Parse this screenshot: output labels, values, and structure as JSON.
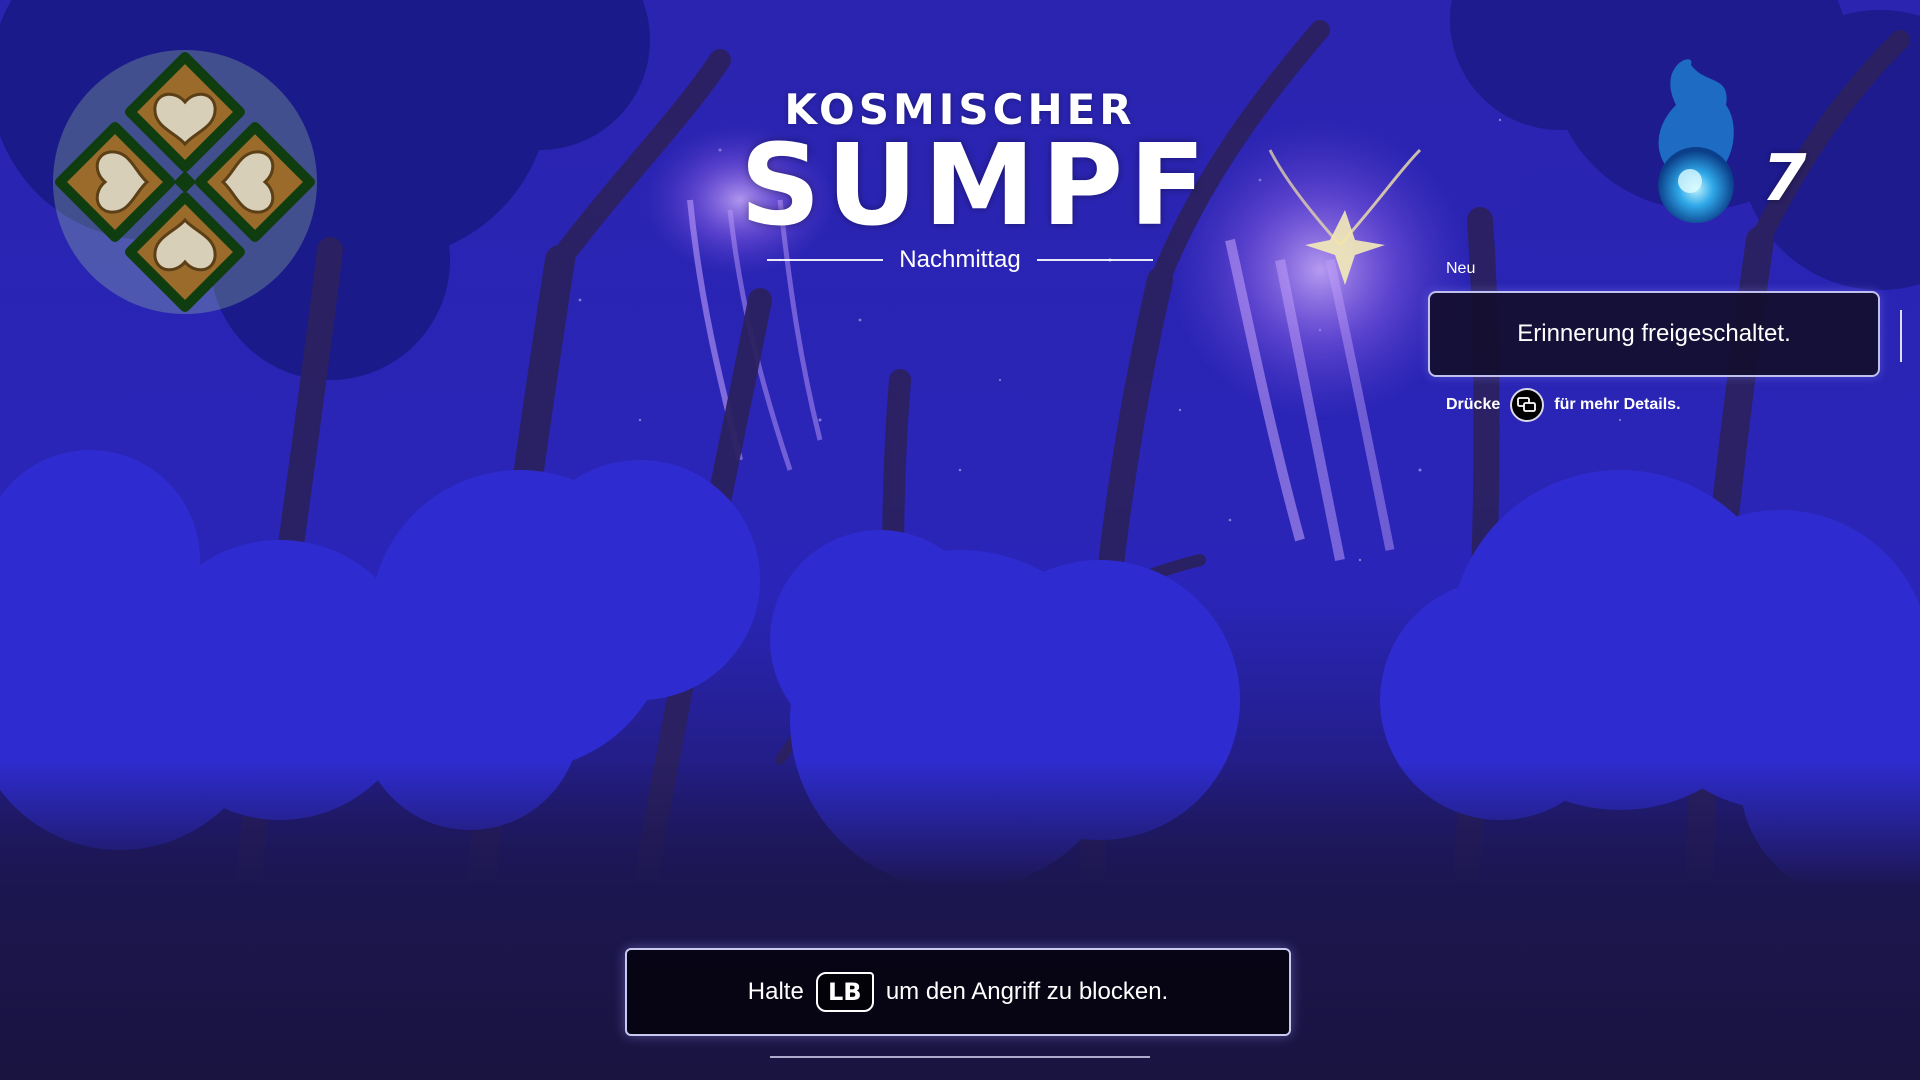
{
  "area": {
    "title_top": "KOSMISCHER",
    "title_main": "SUMPF",
    "time_of_day": "Nachmittag"
  },
  "currency": {
    "icon": "blue-spirit-flame-icon",
    "count": "7"
  },
  "notification": {
    "tag": "Neu",
    "message": "Erinnerung freigeschaltet.",
    "hint_prefix": "Drücke",
    "hint_button_icon": "view-button-icon",
    "hint_suffix": "für mehr Details."
  },
  "tutorial_prompt": {
    "prefix": "Halte",
    "button": "LB",
    "suffix": "um den Angriff zu blocken."
  },
  "emblem": {
    "icon": "four-hearts-clover-emblem-icon"
  },
  "colors": {
    "sky": "#2a22a8",
    "foliage": "#2d2bd0",
    "tree_trunks": "#2a1f5c",
    "ground": "#1b1640",
    "jellyfish_glow": "#b58cff"
  }
}
